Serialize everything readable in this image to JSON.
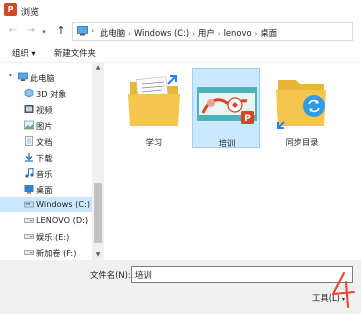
{
  "window": {
    "title": "浏览",
    "app_icon_letter": "P"
  },
  "address_bar": {
    "breadcrumb": [
      "此电脑",
      "Windows (C:)",
      "用户",
      "lenovo",
      "桌面"
    ]
  },
  "toolbar": {
    "organize_label": "组织 ▾",
    "new_folder_label": "新建文件夹"
  },
  "nav_pane": {
    "items": [
      {
        "label": "此电脑",
        "icon": "computer-icon"
      },
      {
        "label": "3D 对象",
        "icon": "3d-objects-icon"
      },
      {
        "label": "视频",
        "icon": "videos-icon"
      },
      {
        "label": "图片",
        "icon": "pictures-icon"
      },
      {
        "label": "文档",
        "icon": "documents-icon"
      },
      {
        "label": "下载",
        "icon": "downloads-icon"
      },
      {
        "label": "音乐",
        "icon": "music-icon"
      },
      {
        "label": "桌面",
        "icon": "desktop-icon"
      },
      {
        "label": "Windows (C:)",
        "icon": "drive-icon",
        "selected": true
      },
      {
        "label": "LENOVO (D:)",
        "icon": "drive-icon"
      },
      {
        "label": "娱乐 (E:)",
        "icon": "drive-icon"
      },
      {
        "label": "新加卷 (F:)",
        "icon": "drive-icon"
      }
    ]
  },
  "files": [
    {
      "name": "学习",
      "type": "folder-documents"
    },
    {
      "name": "培训",
      "type": "pptx-thumbnail",
      "selected": true
    },
    {
      "name": "同步目录",
      "type": "folder-sync"
    }
  ],
  "bottom": {
    "filename_label": "文件名(N):",
    "filename_value": "培训",
    "tools_label": "工具(L)"
  },
  "colors": {
    "selection_bg": "#cce8ff",
    "selection_border": "#99d1ff",
    "folder_yellow": "#f4c64e",
    "powerpoint_red": "#d24726",
    "annotation_red": "#e8423a"
  }
}
